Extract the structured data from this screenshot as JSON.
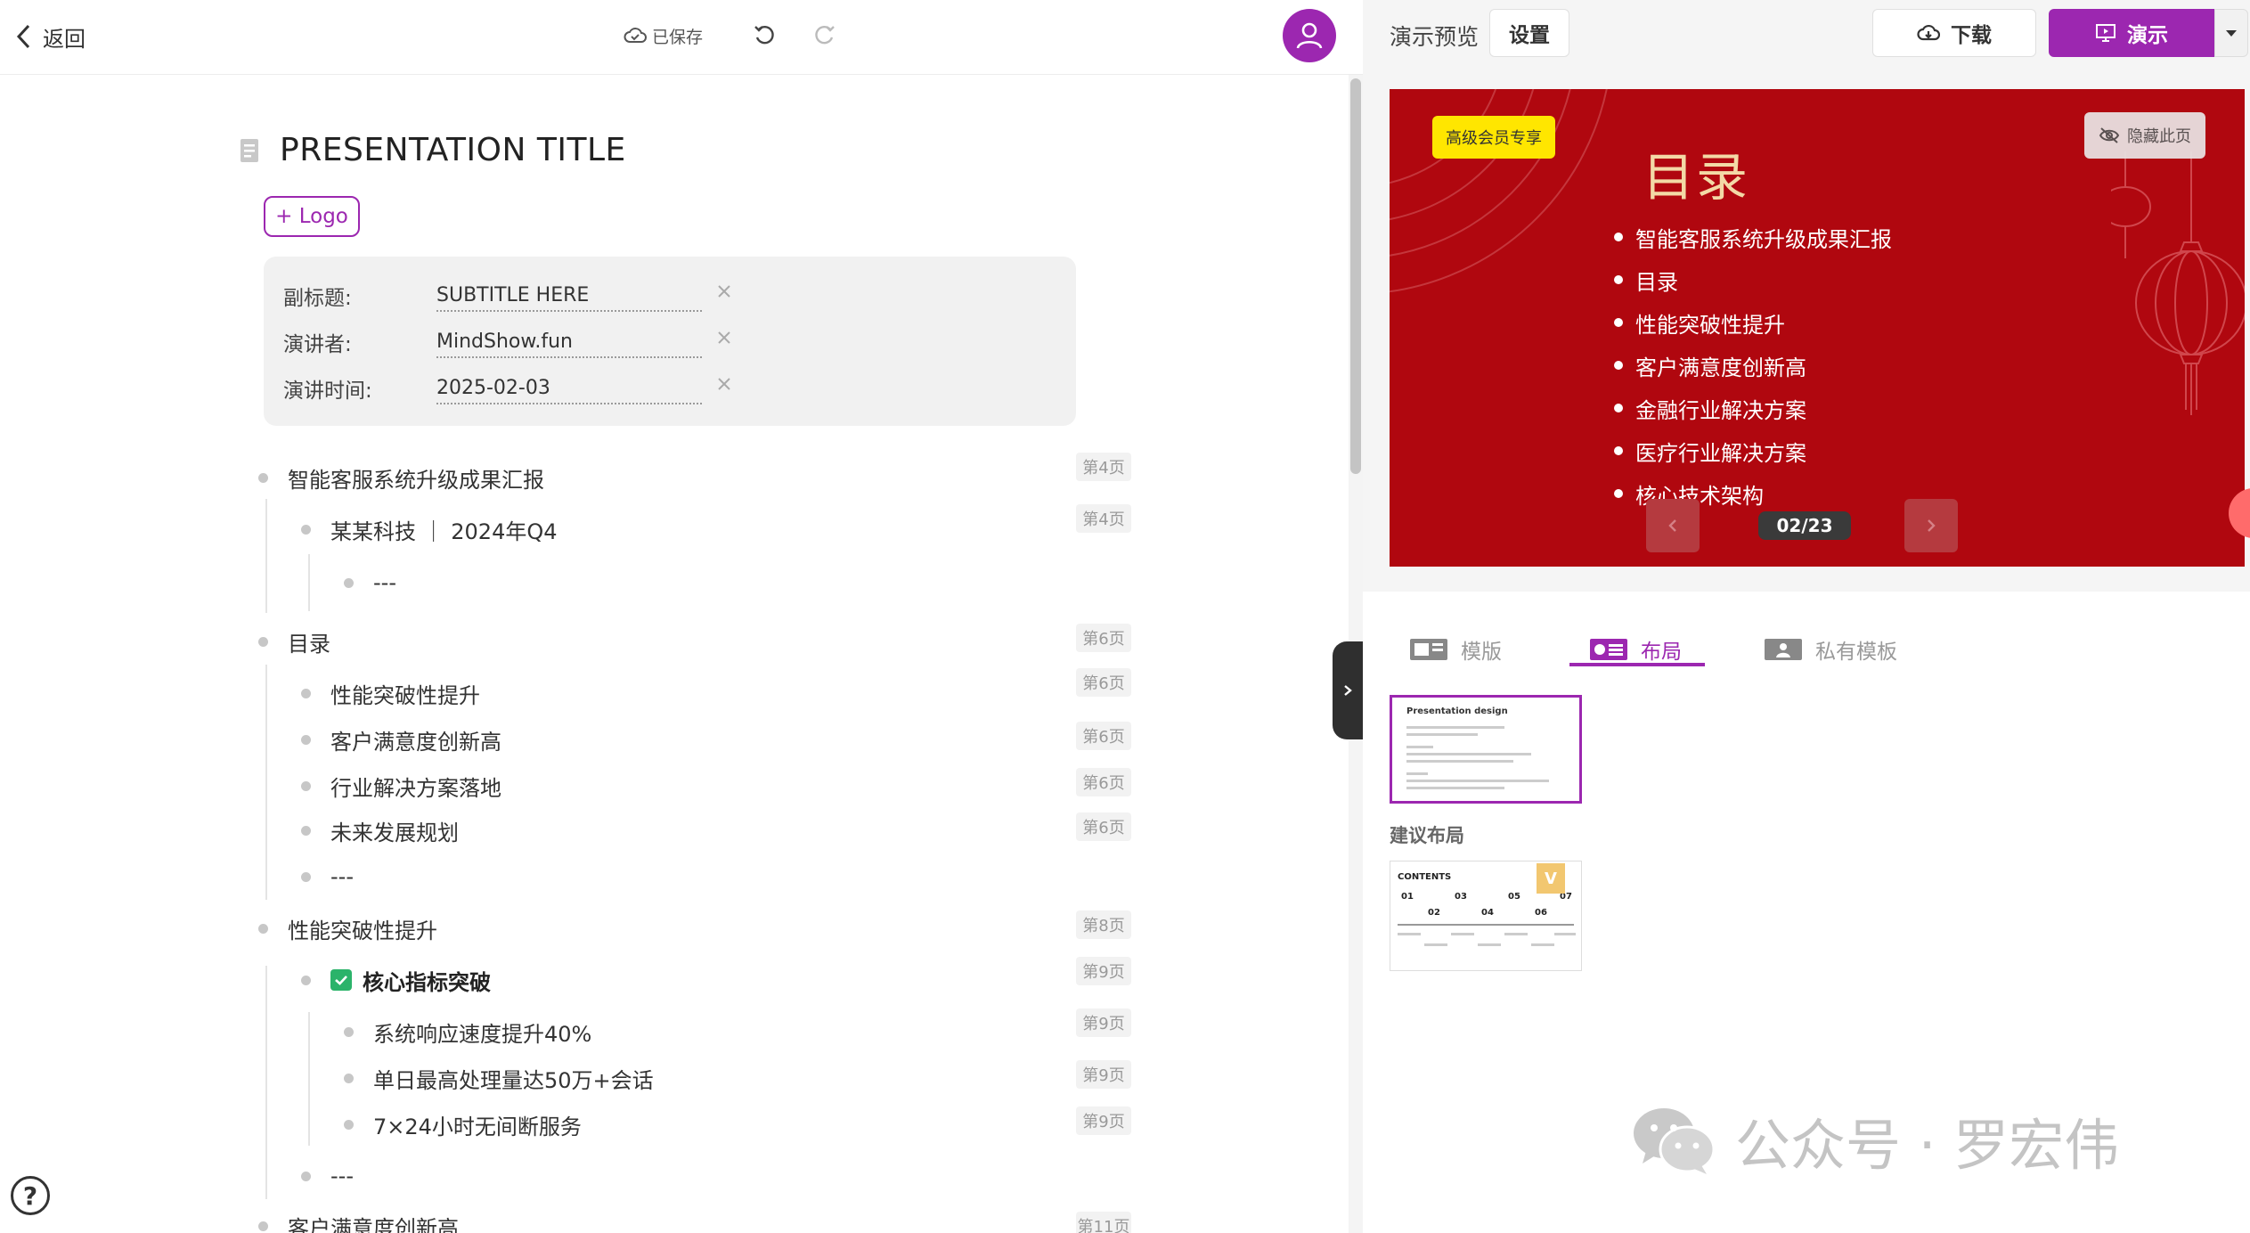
{
  "topbar": {
    "back_label": "返回",
    "saved_label": "已保存"
  },
  "doc": {
    "title": "PRESENTATION TITLE",
    "logo_button": "+ Logo",
    "meta": [
      {
        "label": "副标题:",
        "value": "SUBTITLE HERE"
      },
      {
        "label": "演讲者:",
        "value": "MindShow.fun"
      },
      {
        "label": "演讲时间:",
        "value": "2025-02-03"
      }
    ]
  },
  "outline": [
    {
      "text": "智能客服系统升级成果汇报",
      "page": "第4页"
    },
    {
      "text": "某某科技 ｜ 2024年Q4",
      "page": "第4页"
    },
    {
      "text": "---",
      "page": ""
    },
    {
      "text": "目录",
      "page": "第6页"
    },
    {
      "text": "性能突破性提升",
      "page": "第6页"
    },
    {
      "text": "客户满意度创新高",
      "page": "第6页"
    },
    {
      "text": "行业解决方案落地",
      "page": "第6页"
    },
    {
      "text": "未来发展规划",
      "page": "第6页"
    },
    {
      "text": "---",
      "page": ""
    },
    {
      "text": "性能突破性提升",
      "page": "第8页"
    },
    {
      "text": "核心指标突破",
      "page": "第9页"
    },
    {
      "text": "系统响应速度提升40%",
      "page": "第9页"
    },
    {
      "text": "单日最高处理量达50万+会话",
      "page": "第9页"
    },
    {
      "text": "7×24小时无间断服务",
      "page": "第9页"
    },
    {
      "text": "---",
      "page": ""
    },
    {
      "text": "客户满意度创新高",
      "page": "第11页"
    }
  ],
  "right": {
    "preview_label": "演示预览",
    "settings_button": "设置",
    "download_button": "下载",
    "present_button": "演示"
  },
  "slide": {
    "vip_badge": "高级会员专享",
    "hide_button": "隐藏此页",
    "title": "目录",
    "items": [
      "智能客服系统升级成果汇报",
      "目录",
      "性能突破性提升",
      "客户满意度创新高",
      "金融行业解决方案",
      "医疗行业解决方案",
      "核心技术架构"
    ],
    "page_indicator": "02/23",
    "bg_color": "#b0070f",
    "title_color": "#f3d9a6"
  },
  "tabs": [
    {
      "label": "模版",
      "icon": "template-icon"
    },
    {
      "label": "布局",
      "icon": "layout-icon"
    },
    {
      "label": "私有模板",
      "icon": "private-template-icon"
    }
  ],
  "layouts": {
    "current_thumb_title": "Presentation design",
    "suggest_label": "建议布局",
    "suggest_contents": "CONTENTS",
    "suggest_numbers": [
      "01",
      "02",
      "03",
      "04",
      "05",
      "06",
      "07"
    ],
    "vip_tag": "V"
  },
  "watermark": "公众号 · 罗宏伟",
  "accent_color": "#9c27b0"
}
